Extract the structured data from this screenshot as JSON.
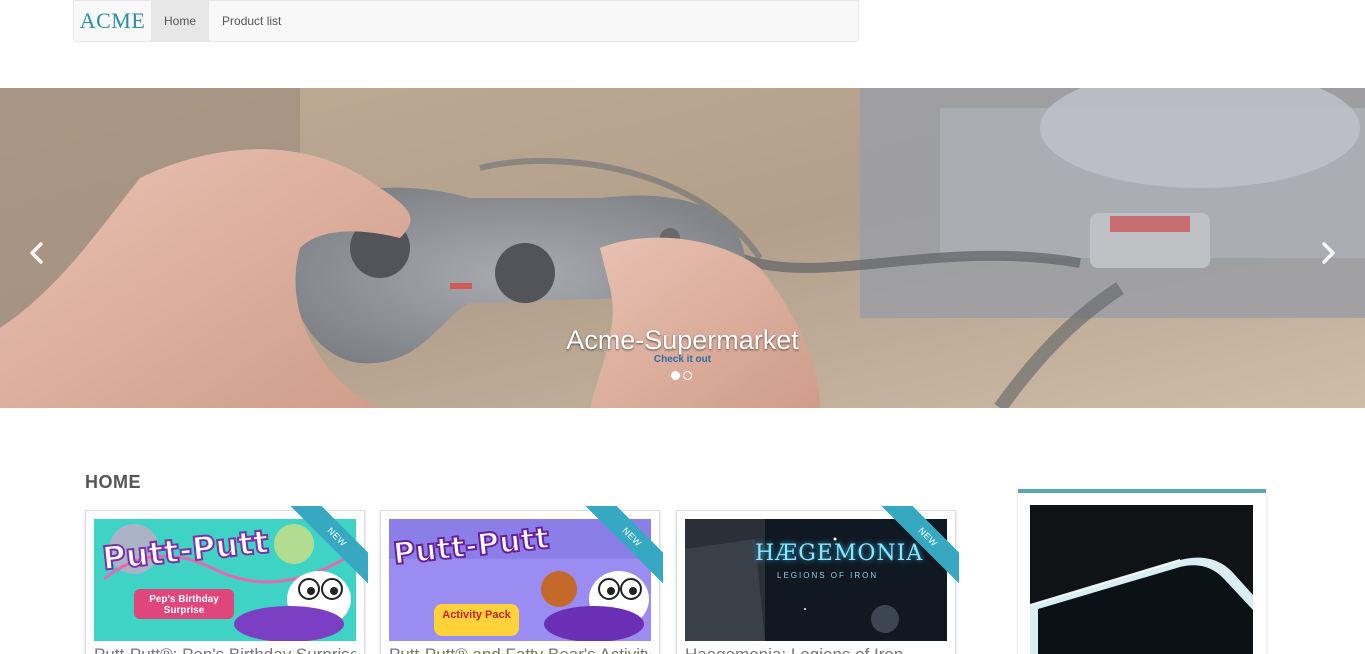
{
  "navbar": {
    "brand": "ACME",
    "items": [
      {
        "label": "Home",
        "active": true
      },
      {
        "label": "Product list",
        "active": false
      }
    ]
  },
  "carousel": {
    "title": "Acme-Supermarket",
    "link": "Check it out",
    "slides_count": 2,
    "active_slide": 1
  },
  "home": {
    "heading": "HOME",
    "products": [
      {
        "title": "Putt-Putt®: Pep's Birthday Surprise",
        "thumb_text": "Putt-Putt",
        "subtitle": "Pep's Birthday Surprise",
        "badge": "NEW"
      },
      {
        "title": "Putt-Putt® and Fatty Bear's Activity Pack",
        "thumb_text": "Putt-Putt",
        "subtitle": "Activity Pack",
        "badge": "NEW"
      },
      {
        "title": "Haegemonia: Legions of Iron",
        "thumb_text": "HÆGEMONIA",
        "subtitle": "LEGIONS OF IRON",
        "badge": "NEW"
      }
    ]
  },
  "colors": {
    "accent": "#36a8c2",
    "brand": "#2a8fa0",
    "sidebar_border": "#5aa7b0"
  }
}
